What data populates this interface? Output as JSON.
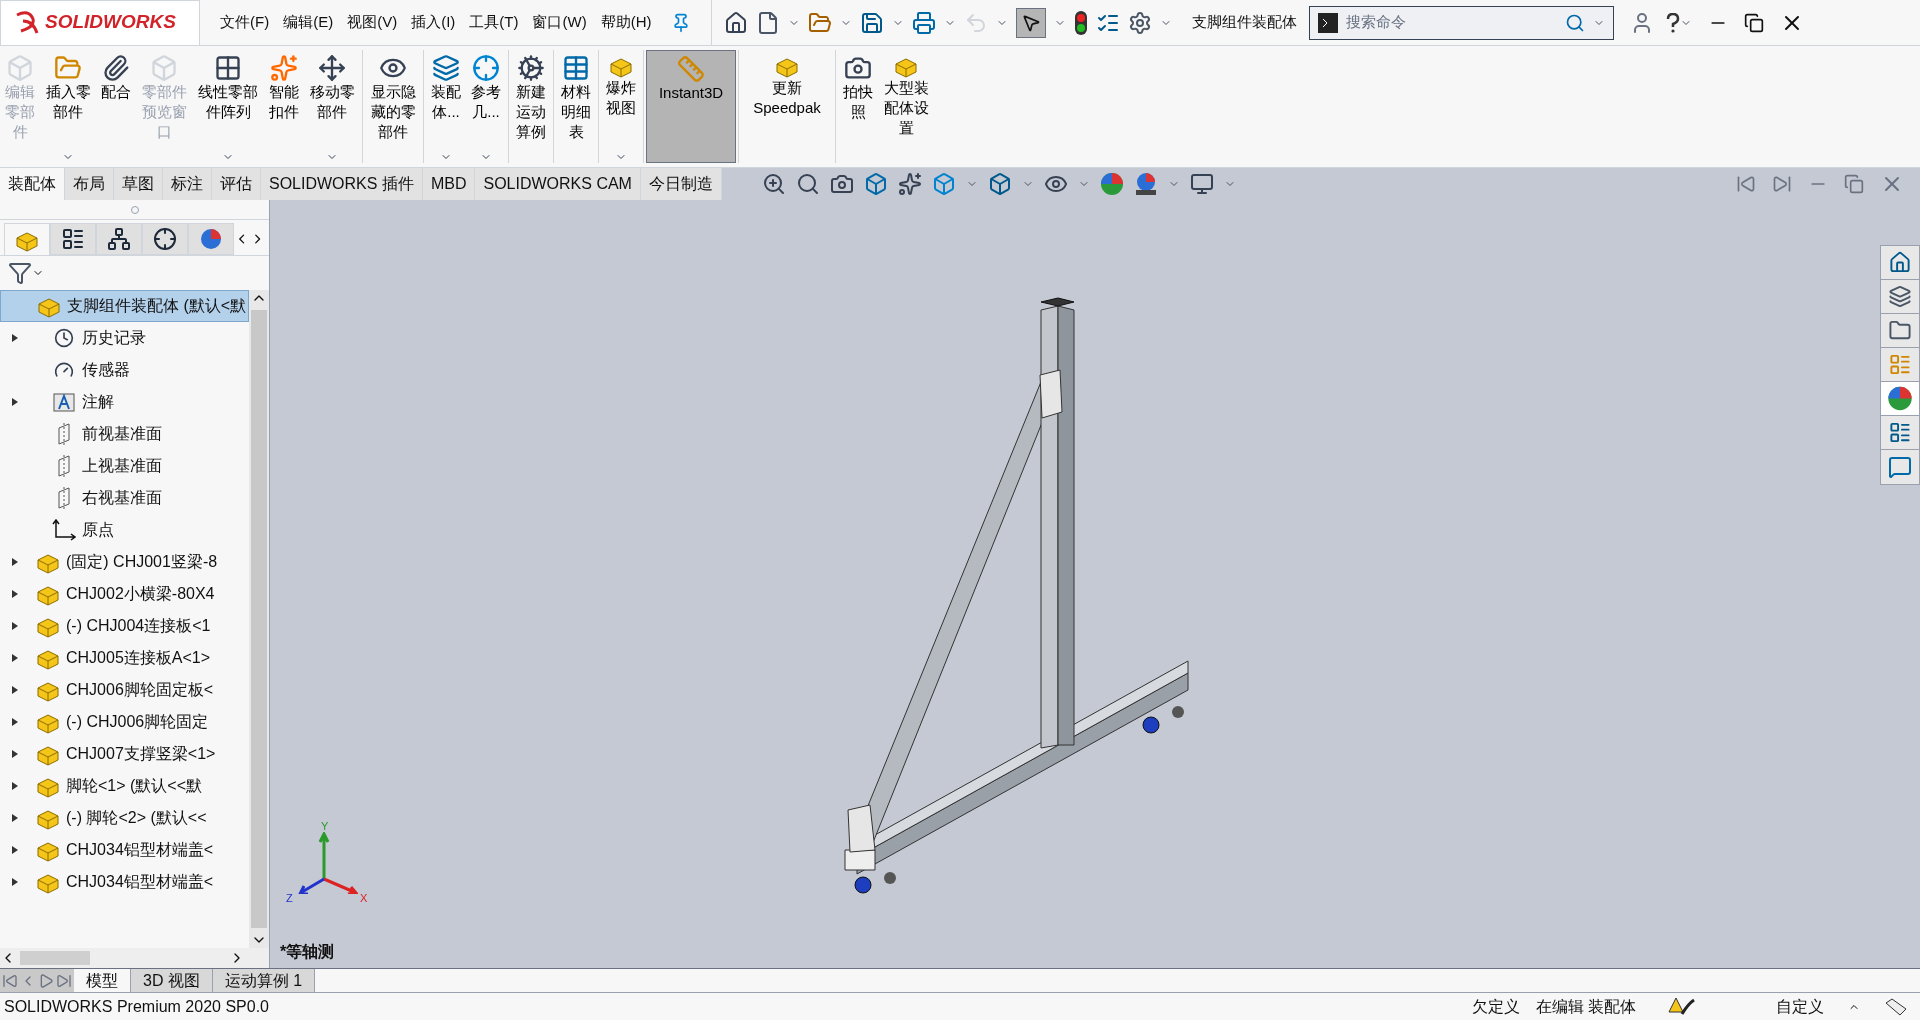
{
  "logo": {
    "text": "SOLIDWORKS"
  },
  "menus": [
    "文件(F)",
    "编辑(E)",
    "视图(V)",
    "插入(I)",
    "工具(T)",
    "窗口(W)",
    "帮助(H)"
  ],
  "document_title": "支脚组件装配体",
  "search": {
    "placeholder": "搜索命令"
  },
  "ribbon": [
    {
      "label": "编辑零部件",
      "disabled": true,
      "dropdown": false,
      "selected": false
    },
    {
      "label": "插入零部件",
      "disabled": false,
      "dropdown": true,
      "selected": false
    },
    {
      "label": "配合",
      "disabled": false,
      "dropdown": false,
      "selected": false
    },
    {
      "label": "零部件预览窗口",
      "disabled": true,
      "dropdown": false,
      "selected": false
    },
    {
      "label": "线性零部件阵列",
      "disabled": false,
      "dropdown": true,
      "selected": false
    },
    {
      "label": "智能扣件",
      "disabled": false,
      "dropdown": false,
      "selected": false
    },
    {
      "label": "移动零部件",
      "disabled": false,
      "dropdown": true,
      "selected": false
    },
    {
      "label": "显示隐藏的零部件",
      "disabled": false,
      "dropdown": false,
      "selected": false
    },
    {
      "label": "装配体...",
      "disabled": false,
      "dropdown": true,
      "selected": false
    },
    {
      "label": "参考几...",
      "disabled": false,
      "dropdown": true,
      "selected": false
    },
    {
      "label": "新建运动算例",
      "disabled": false,
      "dropdown": false,
      "selected": false
    },
    {
      "label": "材料明细表",
      "disabled": false,
      "dropdown": false,
      "selected": false
    },
    {
      "label": "爆炸视图",
      "disabled": false,
      "dropdown": true,
      "selected": false
    },
    {
      "label": "Instant3D",
      "disabled": false,
      "dropdown": false,
      "selected": true
    },
    {
      "label": "更新Speedpak",
      "disabled": false,
      "dropdown": false,
      "selected": false
    },
    {
      "label": "拍快照",
      "disabled": false,
      "dropdown": false,
      "selected": false
    },
    {
      "label": "大型装配体设置",
      "disabled": false,
      "dropdown": false,
      "selected": false
    }
  ],
  "tabs": [
    {
      "label": "装配体",
      "selected": true
    },
    {
      "label": "布局",
      "selected": false
    },
    {
      "label": "草图",
      "selected": false
    },
    {
      "label": "标注",
      "selected": false
    },
    {
      "label": "评估",
      "selected": false
    },
    {
      "label": "SOLIDWORKS 插件",
      "selected": false
    },
    {
      "label": "MBD",
      "selected": false
    },
    {
      "label": "SOLIDWORKS CAM",
      "selected": false
    },
    {
      "label": "今日制造",
      "selected": false
    }
  ],
  "panel_tabs": [
    {
      "kind": "feature",
      "selected": true
    },
    {
      "kind": "property",
      "selected": false
    },
    {
      "kind": "config",
      "selected": false
    },
    {
      "kind": "dim",
      "selected": false
    },
    {
      "kind": "display",
      "selected": false
    }
  ],
  "tree": [
    {
      "kind": "root",
      "label": "支脚组件装配体 (默认<默",
      "expandable": false,
      "selected": true
    },
    {
      "kind": "history",
      "label": "历史记录",
      "expandable": true,
      "selected": false
    },
    {
      "kind": "sensor",
      "label": "传感器",
      "expandable": false,
      "selected": false
    },
    {
      "kind": "annotation",
      "label": "注解",
      "expandable": true,
      "selected": false
    },
    {
      "kind": "plane",
      "label": "前视基准面",
      "expandable": false,
      "selected": false
    },
    {
      "kind": "plane",
      "label": "上视基准面",
      "expandable": false,
      "selected": false
    },
    {
      "kind": "plane",
      "label": "右视基准面",
      "expandable": false,
      "selected": false
    },
    {
      "kind": "origin",
      "label": "原点",
      "expandable": false,
      "selected": false
    },
    {
      "kind": "part",
      "label": "(固定) CHJ001竖梁-8",
      "expandable": true,
      "selected": false
    },
    {
      "kind": "part",
      "label": "CHJ002小横梁-80X4",
      "expandable": true,
      "selected": false
    },
    {
      "kind": "part",
      "label": "(-) CHJ004连接板<1",
      "expandable": true,
      "selected": false
    },
    {
      "kind": "part",
      "label": "CHJ005连接板A<1>",
      "expandable": true,
      "selected": false
    },
    {
      "kind": "part",
      "label": "CHJ006脚轮固定板<",
      "expandable": true,
      "selected": false
    },
    {
      "kind": "part",
      "label": "(-) CHJ006脚轮固定",
      "expandable": true,
      "selected": false
    },
    {
      "kind": "part",
      "label": "CHJ007支撑竖梁<1>",
      "expandable": true,
      "selected": false
    },
    {
      "kind": "part",
      "label": "脚轮<1> (默认<<默",
      "expandable": true,
      "selected": false
    },
    {
      "kind": "part",
      "label": "(-) 脚轮<2> (默认<<",
      "expandable": true,
      "selected": false
    },
    {
      "kind": "part",
      "label": "CHJ034铝型材端盖<",
      "expandable": true,
      "selected": false
    },
    {
      "kind": "part",
      "label": "CHJ034铝型材端盖<",
      "expandable": true,
      "selected": false
    }
  ],
  "triad": {
    "x": "X",
    "y": "Y",
    "z": "Z"
  },
  "view_label": "*等轴测",
  "bottom_tabs": [
    {
      "label": "模型",
      "selected": true
    },
    {
      "label": "3D 视图",
      "selected": false
    },
    {
      "label": "运动算例 1",
      "selected": false
    }
  ],
  "status_bar": {
    "product": "SOLIDWORKS Premium 2020 SP0.0",
    "definition": "欠定义",
    "mode": "在编辑 装配体",
    "units": "自定义"
  }
}
